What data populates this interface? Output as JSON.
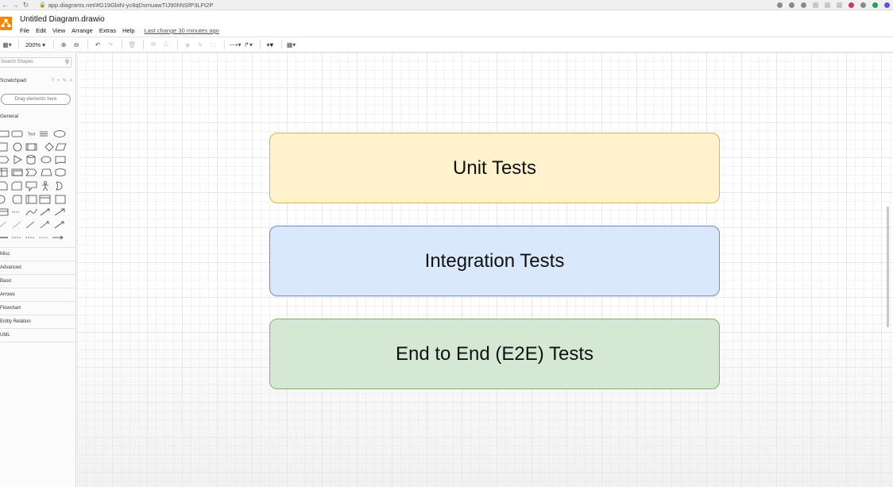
{
  "browser": {
    "url": "app.diagrams.net/#G19GbiN-yc8qDsmuawTIJ90hNSfP3LFt2P"
  },
  "app": {
    "title": "Untitled Diagram.drawio",
    "menu": [
      "File",
      "Edit",
      "View",
      "Arrange",
      "Extras",
      "Help"
    ],
    "last_change": "Last change 30 minutes ago",
    "brand_color": "#f08705"
  },
  "toolbar": {
    "zoom": "200%"
  },
  "sidebar": {
    "search_placeholder": "Search Shapes",
    "scratchpad": "Scratchpad",
    "drag_hint": "Drag elements here",
    "general": "General",
    "shape_text_label": "Text",
    "categories": [
      "Misc",
      "Advanced",
      "Basic",
      "Arrows",
      "Flowchart",
      "Entity Relation",
      "UML"
    ]
  },
  "diagram": {
    "nodes": [
      {
        "label": "Unit Tests",
        "fill": "#fff2cc",
        "stroke": "#d6b656"
      },
      {
        "label": "Integration Tests",
        "fill": "#dae8fc",
        "stroke": "#6c8ebf"
      },
      {
        "label": "End to End (E2E) Tests",
        "fill": "#d5e8d4",
        "stroke": "#82b366"
      }
    ]
  }
}
